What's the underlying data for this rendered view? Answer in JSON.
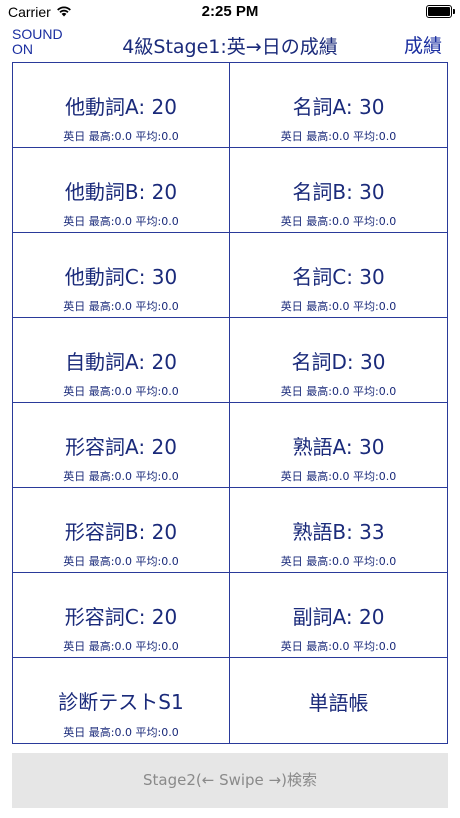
{
  "status_bar": {
    "carrier": "Carrier",
    "time": "2:25 PM"
  },
  "nav": {
    "sound_line1": "SOUND",
    "sound_line2": "ON",
    "title": "4級Stage1:英→日の成績",
    "results_label": "成績"
  },
  "cells": [
    {
      "title": "他動詞A: 20",
      "stats": "英日 最高:0.0 平均:0.0"
    },
    {
      "title": "名詞A: 30",
      "stats": "英日 最高:0.0 平均:0.0"
    },
    {
      "title": "他動詞B: 20",
      "stats": "英日 最高:0.0 平均:0.0"
    },
    {
      "title": "名詞B: 30",
      "stats": "英日 最高:0.0 平均:0.0"
    },
    {
      "title": "他動詞C: 30",
      "stats": "英日 最高:0.0 平均:0.0"
    },
    {
      "title": "名詞C: 30",
      "stats": "英日 最高:0.0 平均:0.0"
    },
    {
      "title": "自動詞A: 20",
      "stats": "英日 最高:0.0 平均:0.0"
    },
    {
      "title": "名詞D: 30",
      "stats": "英日 最高:0.0 平均:0.0"
    },
    {
      "title": "形容詞A: 20",
      "stats": "英日 最高:0.0 平均:0.0"
    },
    {
      "title": "熟語A: 30",
      "stats": "英日 最高:0.0 平均:0.0"
    },
    {
      "title": "形容詞B: 20",
      "stats": "英日 最高:0.0 平均:0.0"
    },
    {
      "title": "熟語B: 33",
      "stats": "英日 最高:0.0 平均:0.0"
    },
    {
      "title": "形容詞C: 20",
      "stats": "英日 最高:0.0 平均:0.0"
    },
    {
      "title": "副詞A: 20",
      "stats": "英日 最高:0.0 平均:0.0"
    },
    {
      "title": "診断テストS1",
      "stats": "英日 最高:0.0 平均:0.0"
    },
    {
      "title": "単語帳",
      "stats": ""
    }
  ],
  "footer": {
    "label": "Stage2(← Swipe →)検索"
  }
}
